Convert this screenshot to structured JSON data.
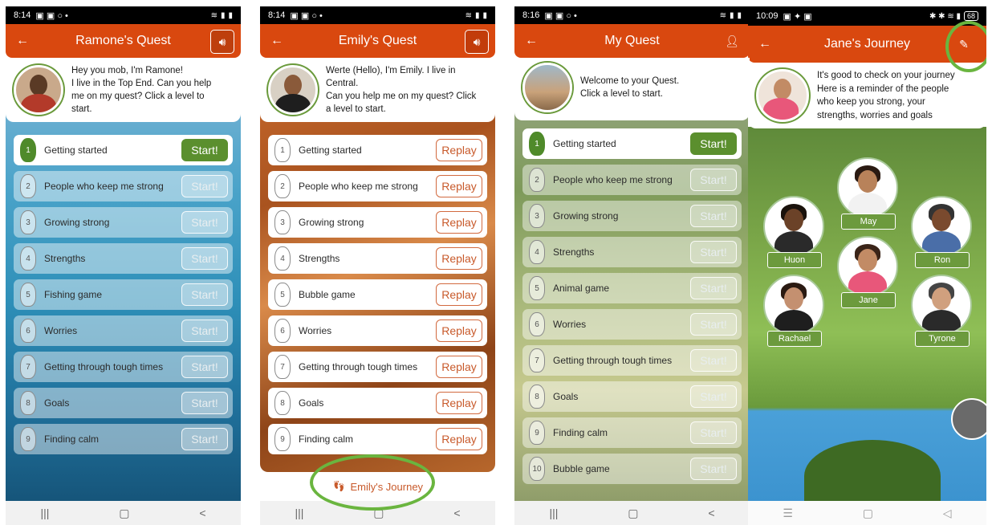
{
  "screen1": {
    "status_time": "8:14",
    "title": "Ramone's Quest",
    "intro": [
      "Hey you mob, I'm Ramone!",
      "I live in the Top End. Can you help",
      "me on my quest? Click a level to",
      "start."
    ],
    "levels": [
      {
        "num": "1",
        "label": "Getting started",
        "button": "Start!"
      },
      {
        "num": "2",
        "label": "People who keep me strong",
        "button": "Start!"
      },
      {
        "num": "3",
        "label": "Growing strong",
        "button": "Start!"
      },
      {
        "num": "4",
        "label": "Strengths",
        "button": "Start!"
      },
      {
        "num": "5",
        "label": "Fishing game",
        "button": "Start!"
      },
      {
        "num": "6",
        "label": "Worries",
        "button": "Start!"
      },
      {
        "num": "7",
        "label": "Getting through tough times",
        "button": "Start!"
      },
      {
        "num": "8",
        "label": "Goals",
        "button": "Start!"
      },
      {
        "num": "9",
        "label": "Finding calm",
        "button": "Start!"
      }
    ]
  },
  "screen2": {
    "status_time": "8:14",
    "title": "Emily's Quest",
    "intro": [
      "Werte (Hello), I'm Emily. I live in",
      "Central.",
      "Can you help me on my quest? Click",
      "a level to start."
    ],
    "levels": [
      {
        "num": "1",
        "label": "Getting started",
        "button": "Replay"
      },
      {
        "num": "2",
        "label": "People who keep me strong",
        "button": "Replay"
      },
      {
        "num": "3",
        "label": "Growing strong",
        "button": "Replay"
      },
      {
        "num": "4",
        "label": "Strengths",
        "button": "Replay"
      },
      {
        "num": "5",
        "label": "Bubble game",
        "button": "Replay"
      },
      {
        "num": "6",
        "label": "Worries",
        "button": "Replay"
      },
      {
        "num": "7",
        "label": "Getting through tough times",
        "button": "Replay"
      },
      {
        "num": "8",
        "label": "Goals",
        "button": "Replay"
      },
      {
        "num": "9",
        "label": "Finding calm",
        "button": "Replay"
      }
    ],
    "journey_link": "Emily's Journey"
  },
  "screen3": {
    "status_time": "8:16",
    "title": "My Quest",
    "intro": [
      "Welcome to your Quest.",
      "Click a level to start."
    ],
    "levels": [
      {
        "num": "1",
        "label": "Getting started",
        "button": "Start!"
      },
      {
        "num": "2",
        "label": "People who keep me strong",
        "button": "Start!"
      },
      {
        "num": "3",
        "label": "Growing strong",
        "button": "Start!"
      },
      {
        "num": "4",
        "label": "Strengths",
        "button": "Start!"
      },
      {
        "num": "5",
        "label": "Animal game",
        "button": "Start!"
      },
      {
        "num": "6",
        "label": "Worries",
        "button": "Start!"
      },
      {
        "num": "7",
        "label": "Getting through tough times",
        "button": "Start!"
      },
      {
        "num": "8",
        "label": "Goals",
        "button": "Start!"
      },
      {
        "num": "9",
        "label": "Finding calm",
        "button": "Start!"
      },
      {
        "num": "10",
        "label": "Bubble game",
        "button": "Start!"
      }
    ]
  },
  "screen4": {
    "status_time": "10:09",
    "battery": "68",
    "title": "Jane's Journey",
    "intro": [
      "It's good to check on your journey",
      "Here is a reminder of the people",
      "who keep you strong, your",
      "strengths, worries and goals"
    ],
    "people": [
      "May",
      "Huon",
      "Ron",
      "Jane",
      "Rachael",
      "Tyrone"
    ]
  },
  "icons": {
    "back": "back-arrow-icon",
    "sound": "speaker-icon",
    "profile": "person-icon",
    "edit": "edit-icon",
    "footsteps": "footsteps-icon"
  },
  "colors": {
    "header": "#d9480f",
    "green": "#5b8f2e",
    "replay": "#c85a2b",
    "highlight": "#6ab53f"
  }
}
